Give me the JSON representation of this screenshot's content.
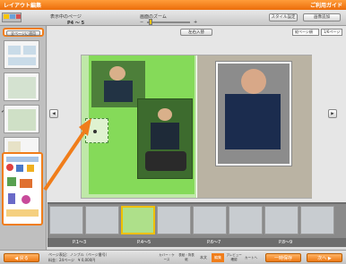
{
  "window": {
    "title": "レイアウト編集",
    "help_label": "ご利用ガイド"
  },
  "toolbar": {
    "page_label": "表示中のページ",
    "page_value": "P4 〜 5",
    "zoom_label": "画面のズーム",
    "zoom_minus": "−",
    "zoom_plus": "+",
    "btn1_label": "スタイル設定",
    "btn2_label": "画像追加"
  },
  "sidebar": {
    "apply_all_label": "全ページに適用",
    "check_mark": "✓"
  },
  "canvas": {
    "left_right_button": "左右入替",
    "select_value": "縦ページ順",
    "select_value2": "1/6ページ",
    "prev_arrow": "◀",
    "next_arrow": "▶"
  },
  "filmstrip": {
    "labels": [
      "P.1〜3",
      "P.4〜5",
      "P.6〜7",
      "P.8〜9"
    ]
  },
  "footer": {
    "back_label": "◀ 戻る",
    "info_line1": "ページ表記：ノンブル（ページ番号）",
    "info_line2": "料金：24ページ　¥ 0,000円",
    "tab1": "カバー・ケース",
    "tab2": "表紙・背表紙",
    "tab3": "本文",
    "tab4": "編集",
    "tab5": "プレビュー確認",
    "tab6": "カートへ",
    "save_label": "一時保存",
    "next_label": "次へ ▶"
  }
}
